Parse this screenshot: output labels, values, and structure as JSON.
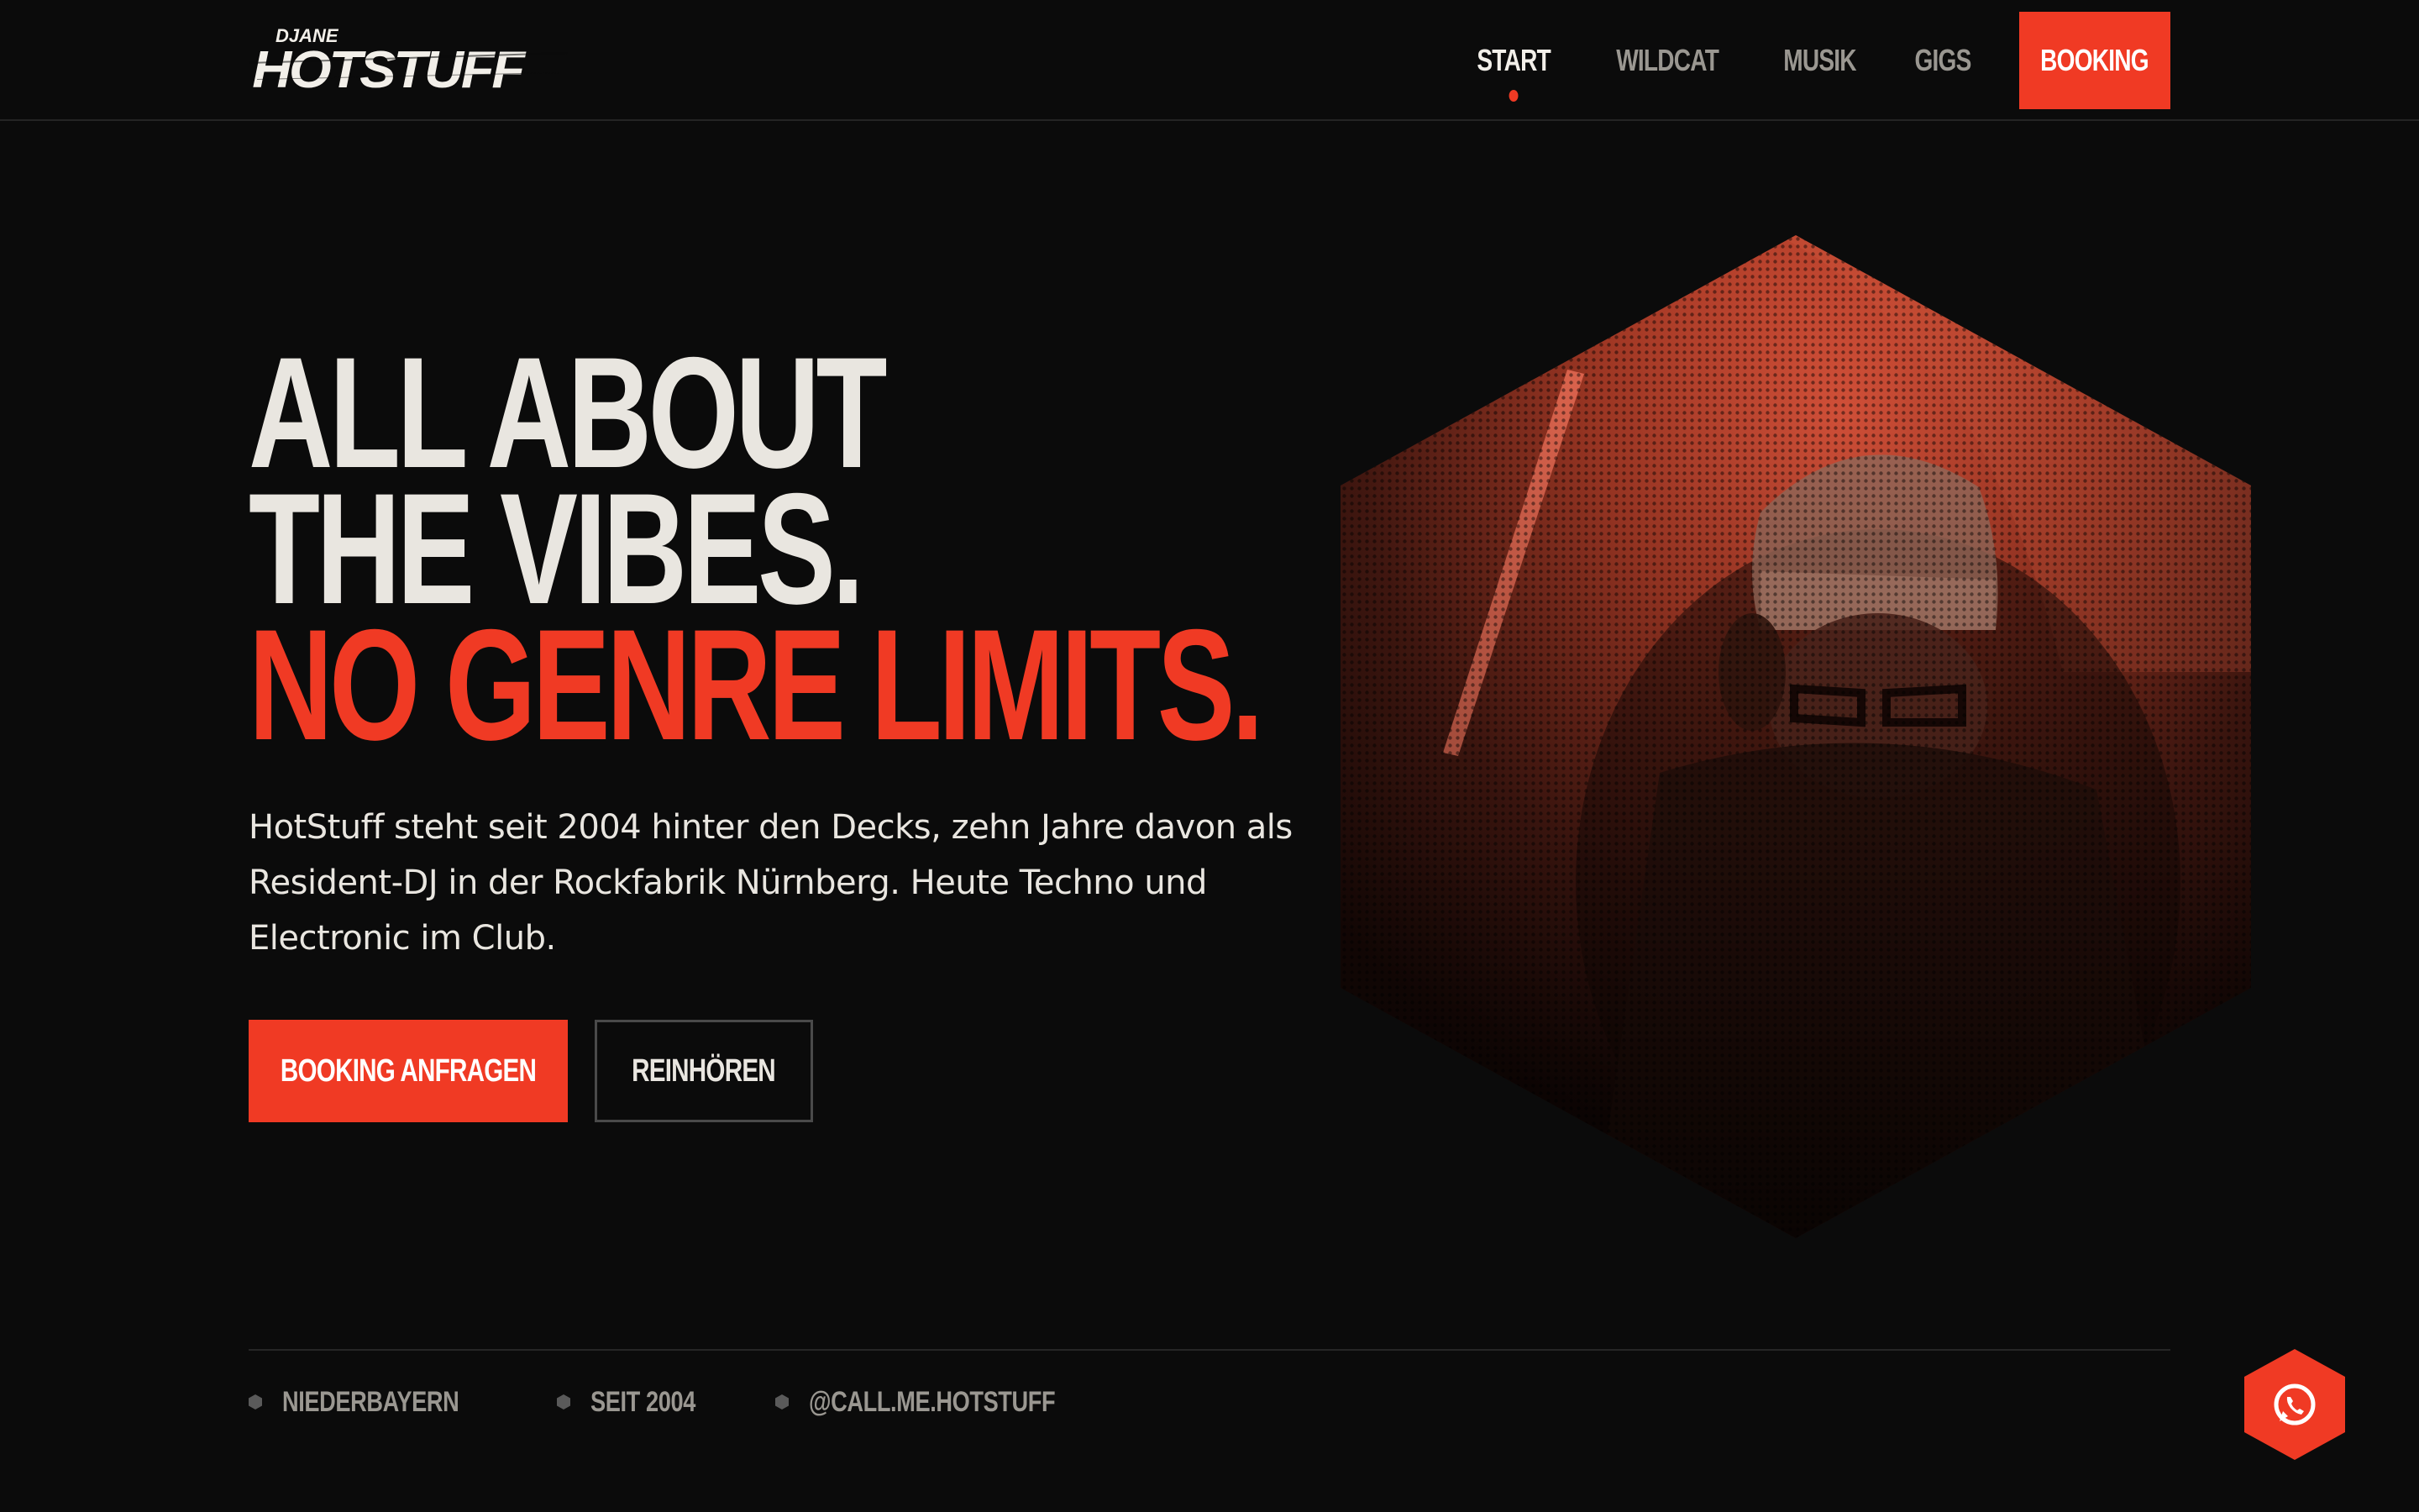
{
  "brand": {
    "logo_prefix": "DJANE",
    "logo_text": "HOTSTUFF"
  },
  "nav": {
    "items": [
      {
        "label": "START",
        "active": true
      },
      {
        "label": "WILDCAT",
        "active": false
      },
      {
        "label": "MUSIK",
        "active": false
      },
      {
        "label": "GIGS",
        "active": false
      }
    ],
    "booking_label": "BOOKING"
  },
  "hero": {
    "headline_line1": "ALL ABOUT",
    "headline_line2": "THE VIBES.",
    "headline_accent": "NO GENRE LIMITS.",
    "intro": "HotStuff steht seit 2004 hinter den Decks, zehn Jahre davon als Resident-DJ in der Rockfabrik Nürnberg. Heute Techno und Electronic im Club.",
    "primary_cta": "BOOKING ANFRAGEN",
    "secondary_cta": "REINHÖREN",
    "image_icon": "hexagon-dj-photo"
  },
  "facts": [
    {
      "label": "NIEDERBAYERN",
      "icon": "hexagon-bullet-icon"
    },
    {
      "label": "SEIT 2004",
      "icon": "hexagon-bullet-icon"
    },
    {
      "label": "@CALL.ME.HOTSTUFF",
      "icon": "hexagon-bullet-icon"
    }
  ],
  "floating": {
    "whatsapp_icon": "whatsapp-icon"
  },
  "colors": {
    "accent": "#f03a24",
    "background": "#0b0b0b",
    "text": "#e9e6e0",
    "muted": "#9a9791"
  }
}
